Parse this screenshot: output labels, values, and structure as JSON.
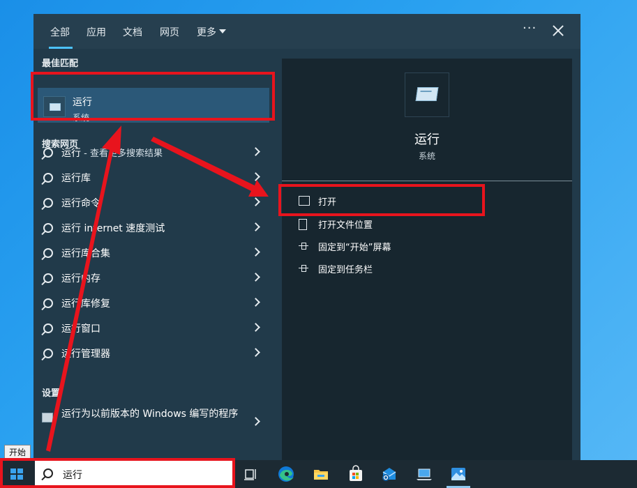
{
  "tabs": [
    {
      "label": "全部"
    },
    {
      "label": "应用"
    },
    {
      "label": "文档"
    },
    {
      "label": "网页"
    },
    {
      "label": "更多"
    }
  ],
  "header": {
    "more_icon": "ellipsis-icon",
    "close_icon": "close-icon"
  },
  "best_match": {
    "section_label": "最佳匹配",
    "title": "运行",
    "subtitle": "系统"
  },
  "web_search": {
    "section_label": "搜索网页",
    "first_item": {
      "query": "运行",
      "suffix": " - 查看更多搜索结果"
    },
    "items": [
      {
        "label": "运行库"
      },
      {
        "label": "运行命令"
      },
      {
        "label": "运行 internet 速度测试"
      },
      {
        "label": "运行库合集"
      },
      {
        "label": "运行内存"
      },
      {
        "label": "运行库修复"
      },
      {
        "label": "运行窗口"
      },
      {
        "label": "运行管理器"
      }
    ]
  },
  "settings": {
    "section_label": "设置",
    "item": "运行为以前版本的 Windows 编写的程序"
  },
  "detail": {
    "title": "运行",
    "subtitle": "系统",
    "actions": [
      {
        "label": "打开"
      },
      {
        "label": "打开文件位置"
      },
      {
        "label": "固定到“开始”屏幕"
      },
      {
        "label": "固定到任务栏"
      }
    ]
  },
  "taskbar": {
    "start_tooltip": "开始",
    "search_value": "运行",
    "icons": [
      "task-view-icon",
      "edge-icon",
      "file-explorer-icon",
      "store-icon",
      "mail-icon",
      "this-pc-icon",
      "photos-icon"
    ]
  },
  "colors": {
    "accent": "#4cc2ff",
    "highlight": "#2b5878",
    "annotation": "#e8141d"
  }
}
